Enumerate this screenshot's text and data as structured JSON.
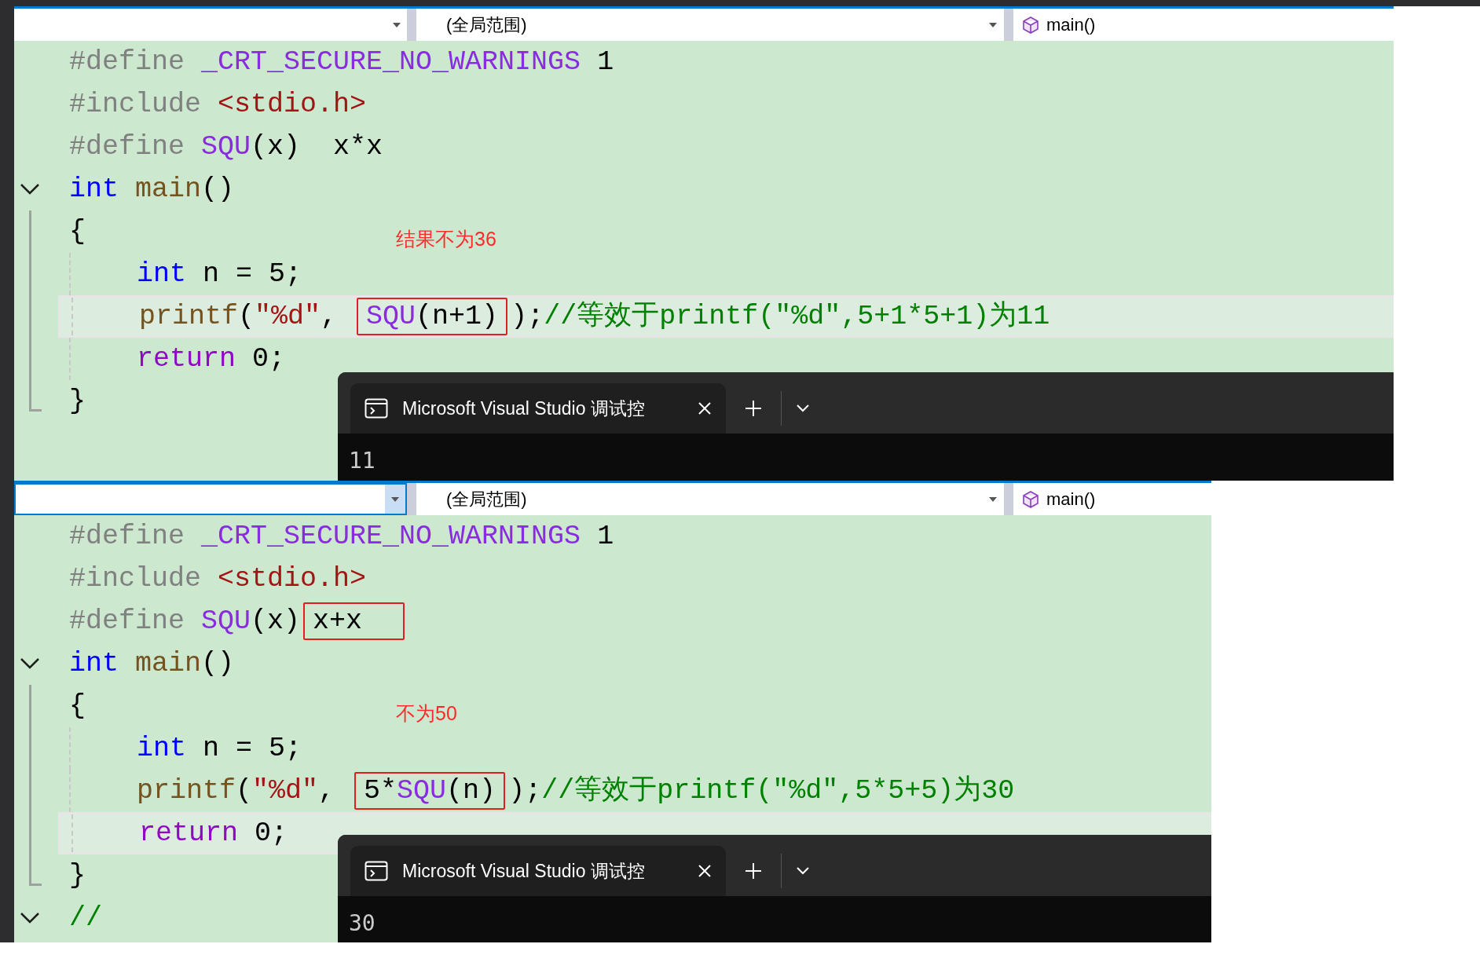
{
  "panels": [
    {
      "nav": {
        "first_focused": false,
        "scope": "(全局范围)",
        "function": "main()"
      },
      "lines": [
        {
          "indented": false,
          "highlighted": false,
          "segments": [
            {
              "boxed": false,
              "tokens": [
                {
                  "kind": "preproc",
                  "text": "#define "
                },
                {
                  "kind": "macro",
                  "text": "_CRT_SECURE_NO_WARNINGS"
                },
                {
                  "kind": "plain",
                  "text": " 1"
                }
              ]
            }
          ]
        },
        {
          "indented": false,
          "highlighted": false,
          "segments": [
            {
              "boxed": false,
              "tokens": [
                {
                  "kind": "preproc",
                  "text": "#include "
                },
                {
                  "kind": "include",
                  "text": "<stdio.h>"
                }
              ]
            }
          ]
        },
        {
          "indented": false,
          "highlighted": false,
          "segments": [
            {
              "boxed": false,
              "tokens": [
                {
                  "kind": "preproc",
                  "text": "#define "
                },
                {
                  "kind": "macro",
                  "text": "SQU"
                },
                {
                  "kind": "plain",
                  "text": "(x)  x*x"
                }
              ]
            }
          ]
        },
        {
          "gutter": {
            "kind": "fold"
          },
          "indented": false,
          "highlighted": false,
          "segments": [
            {
              "boxed": false,
              "tokens": [
                {
                  "kind": "keyword",
                  "text": "int "
                },
                {
                  "kind": "func",
                  "text": "main"
                },
                {
                  "kind": "plain",
                  "text": "()"
                }
              ]
            }
          ]
        },
        {
          "gutter": {
            "kind": "span"
          },
          "indented": false,
          "highlighted": false,
          "segments": [
            {
              "boxed": false,
              "tokens": [
                {
                  "kind": "plain",
                  "text": "{"
                }
              ]
            }
          ]
        },
        {
          "gutter": {
            "kind": "span"
          },
          "indented": true,
          "highlighted": false,
          "note": "结果不为36",
          "segments": [
            {
              "boxed": false,
              "tokens": [
                {
                  "kind": "keyword",
                  "text": "int"
                },
                {
                  "kind": "plain",
                  "text": " n = 5;"
                }
              ]
            }
          ]
        },
        {
          "gutter": {
            "kind": "span"
          },
          "indented": true,
          "highlighted": true,
          "segments": [
            {
              "boxed": false,
              "tokens": [
                {
                  "kind": "func",
                  "text": "printf"
                },
                {
                  "kind": "plain",
                  "text": "("
                },
                {
                  "kind": "string",
                  "text": "\"%d\""
                },
                {
                  "kind": "plain",
                  "text": ", "
                }
              ]
            },
            {
              "boxed": true,
              "tokens": [
                {
                  "kind": "macro",
                  "text": "SQU"
                },
                {
                  "kind": "plain",
                  "text": "(n+1)"
                }
              ]
            },
            {
              "boxed": false,
              "tokens": [
                {
                  "kind": "plain",
                  "text": ");"
                },
                {
                  "kind": "comment",
                  "text": "//等效于printf(\"%d\",5+1*5+1)为11"
                }
              ]
            }
          ]
        },
        {
          "gutter": {
            "kind": "span"
          },
          "indented": true,
          "highlighted": false,
          "segments": [
            {
              "boxed": false,
              "tokens": [
                {
                  "kind": "control",
                  "text": "return"
                },
                {
                  "kind": "plain",
                  "text": " 0;"
                }
              ]
            }
          ]
        },
        {
          "gutter": {
            "kind": "end"
          },
          "indented": false,
          "highlighted": false,
          "segments": [
            {
              "boxed": false,
              "tokens": [
                {
                  "kind": "plain",
                  "text": "}"
                }
              ]
            }
          ]
        }
      ],
      "console": {
        "tab_title": "Microsoft Visual Studio 调试控",
        "output": "11"
      }
    },
    {
      "nav": {
        "first_focused": true,
        "scope": "(全局范围)",
        "function": "main()"
      },
      "lines": [
        {
          "indented": false,
          "highlighted": false,
          "segments": [
            {
              "boxed": false,
              "tokens": [
                {
                  "kind": "preproc",
                  "text": "#define "
                },
                {
                  "kind": "macro",
                  "text": "_CRT_SECURE_NO_WARNINGS"
                },
                {
                  "kind": "plain",
                  "text": " 1"
                }
              ]
            }
          ]
        },
        {
          "indented": false,
          "highlighted": false,
          "segments": [
            {
              "boxed": false,
              "tokens": [
                {
                  "kind": "preproc",
                  "text": "#include "
                },
                {
                  "kind": "include",
                  "text": "<stdio.h>"
                }
              ]
            }
          ]
        },
        {
          "indented": false,
          "highlighted": false,
          "segments": [
            {
              "boxed": false,
              "tokens": [
                {
                  "kind": "preproc",
                  "text": "#define "
                },
                {
                  "kind": "macro",
                  "text": "SQU"
                },
                {
                  "kind": "plain",
                  "text": "(x)"
                }
              ]
            },
            {
              "boxed": true,
              "tokens": [
                {
                  "kind": "plain",
                  "text": "x+x  "
                }
              ]
            }
          ]
        },
        {
          "gutter": {
            "kind": "fold"
          },
          "indented": false,
          "highlighted": false,
          "segments": [
            {
              "boxed": false,
              "tokens": [
                {
                  "kind": "keyword",
                  "text": "int "
                },
                {
                  "kind": "func",
                  "text": "main"
                },
                {
                  "kind": "plain",
                  "text": "()"
                }
              ]
            }
          ]
        },
        {
          "gutter": {
            "kind": "span"
          },
          "indented": false,
          "highlighted": false,
          "segments": [
            {
              "boxed": false,
              "tokens": [
                {
                  "kind": "plain",
                  "text": "{"
                }
              ]
            }
          ]
        },
        {
          "gutter": {
            "kind": "span"
          },
          "indented": true,
          "highlighted": false,
          "note": "不为50",
          "segments": [
            {
              "boxed": false,
              "tokens": [
                {
                  "kind": "keyword",
                  "text": "int"
                },
                {
                  "kind": "plain",
                  "text": " n = 5;"
                }
              ]
            }
          ]
        },
        {
          "gutter": {
            "kind": "span"
          },
          "indented": true,
          "highlighted": false,
          "segments": [
            {
              "boxed": false,
              "tokens": [
                {
                  "kind": "func",
                  "text": "printf"
                },
                {
                  "kind": "plain",
                  "text": "("
                },
                {
                  "kind": "string",
                  "text": "\"%d\""
                },
                {
                  "kind": "plain",
                  "text": ", "
                }
              ]
            },
            {
              "boxed": true,
              "tokens": [
                {
                  "kind": "plain",
                  "text": "5*"
                },
                {
                  "kind": "macro",
                  "text": "SQU"
                },
                {
                  "kind": "plain",
                  "text": "(n)"
                }
              ]
            },
            {
              "boxed": false,
              "tokens": [
                {
                  "kind": "plain",
                  "text": ");"
                },
                {
                  "kind": "comment",
                  "text": "//等效于printf(\"%d\",5*5+5)为30"
                }
              ]
            }
          ]
        },
        {
          "gutter": {
            "kind": "span"
          },
          "indented": true,
          "highlighted": true,
          "segments": [
            {
              "boxed": false,
              "tokens": [
                {
                  "kind": "control",
                  "text": "return"
                },
                {
                  "kind": "plain",
                  "text": " 0;"
                }
              ]
            }
          ]
        },
        {
          "gutter": {
            "kind": "end"
          },
          "indented": false,
          "highlighted": false,
          "segments": [
            {
              "boxed": false,
              "tokens": [
                {
                  "kind": "plain",
                  "text": "}"
                }
              ]
            }
          ]
        },
        {
          "gutter": {
            "kind": "fold"
          },
          "indented": false,
          "highlighted": false,
          "segments": [
            {
              "boxed": false,
              "tokens": [
                {
                  "kind": "comment",
                  "text": "//"
                }
              ]
            }
          ]
        }
      ],
      "console": {
        "tab_title": "Microsoft Visual Studio 调试控",
        "output": "30"
      }
    }
  ]
}
